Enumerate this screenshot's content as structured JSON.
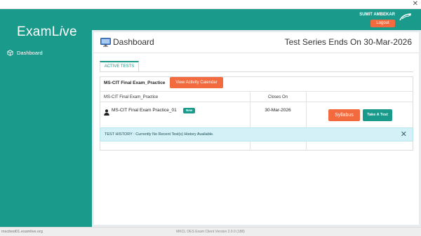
{
  "window": {
    "close_glyph": "✕"
  },
  "brand": {
    "name_part1": "ExamL",
    "name_part2": "i",
    "name_part3": "ve"
  },
  "sidebar": {
    "items": [
      {
        "label": "Dashboard",
        "icon": "cube-icon"
      }
    ]
  },
  "header": {
    "user_name": "SUMIT AMBEKAR",
    "logout_label": "Logout"
  },
  "page": {
    "title": "Dashboard",
    "series_ends": "Test Series Ends On 30-Mar-2026"
  },
  "tabs": [
    {
      "label": "ACTIVE TESTS",
      "active": true
    }
  ],
  "tests": {
    "section_title": "MS-CIT Final Exam_Practice",
    "calendar_button": "View Activity Calendar",
    "header_name": "MS-CIT Final Exam_Practice",
    "header_closes": "Closes On",
    "rows": [
      {
        "name": "MS-CIT Final Exam Practice_01",
        "badge": "New",
        "closes_on": "30-Mar-2026",
        "syllabus_label": "Syllabus",
        "take_test_label": "Take A Test"
      }
    ]
  },
  "history_alert": {
    "text": "TEST HISTORY : Currently No Recent Test(s) History Available.",
    "close_glyph": "✕"
  },
  "footer": {
    "left": "mscitest01.examlive.org",
    "center": "MKCL OES Exam Client Version 2.0.0 (188)"
  },
  "colors": {
    "primary": "#1a9a8b",
    "accent": "#f26a3d",
    "alert_bg": "#d3f1f6"
  }
}
